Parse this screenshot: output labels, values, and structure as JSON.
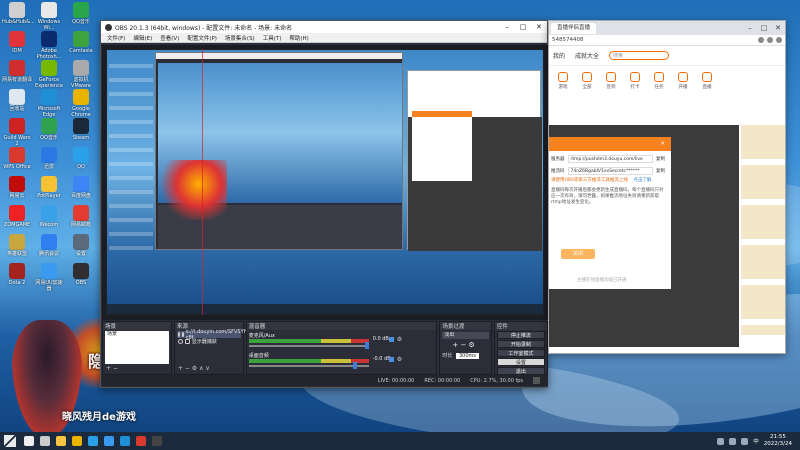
{
  "desktop": {
    "icons": [
      {
        "label": "Hub&Hub&...",
        "color": "#d0d0d0"
      },
      {
        "label": "Windows Wi...",
        "color": "#e8e8e8"
      },
      {
        "label": "QQ音乐",
        "color": "#2aa64a"
      },
      {
        "label": "IDM",
        "color": "#e0343a"
      },
      {
        "label": "Adobe Photosh...",
        "color": "#0c2a6e"
      },
      {
        "label": "Camtasia",
        "color": "#3ea23e"
      },
      {
        "label": "网易有道翻译",
        "color": "#d02e2e"
      },
      {
        "label": "GeForce Experience",
        "color": "#76b900"
      },
      {
        "label": "虚拟机 VMware",
        "color": "#aaaaaa"
      },
      {
        "label": "回收站",
        "color": "#dfe8f0"
      },
      {
        "label": "Microsoft Edge",
        "color": "#1f8fd6"
      },
      {
        "label": "Google Chrome",
        "color": "#e8b400"
      },
      {
        "label": "Guild Wars 2",
        "color": "#c22"
      },
      {
        "label": "QQ音乐",
        "color": "#30a14e"
      },
      {
        "label": "Steam",
        "color": "#1b2838"
      },
      {
        "label": "WPS Office",
        "color": "#d83a2d"
      },
      {
        "label": "迅雷",
        "color": "#2b79e2"
      },
      {
        "label": "QQ",
        "color": "#2aa0e8"
      },
      {
        "label": "网易云",
        "color": "#c20c0c"
      },
      {
        "label": "PotPlayer",
        "color": "#f6c234"
      },
      {
        "label": "百度网盘",
        "color": "#3b85f5"
      },
      {
        "label": "ZOMGAME",
        "color": "#e22"
      },
      {
        "label": "Wecom",
        "color": "#3aa0e8"
      },
      {
        "label": "网易邮箱",
        "color": "#e23b30"
      },
      {
        "label": "英雄联盟",
        "color": "#c8a640"
      },
      {
        "label": "腾讯会议",
        "color": "#2f7ff0"
      },
      {
        "label": "设置",
        "color": "#5a6a7a"
      },
      {
        "label": "Dota 2",
        "color": "#a3231d"
      },
      {
        "label": "网易UU加速器",
        "color": "#3a9af0"
      },
      {
        "label": "OBS",
        "color": "#302e31"
      }
    ],
    "mascot_logo": "隐轩",
    "mascot_sub": "晓风残月de游戏"
  },
  "obs": {
    "title": "OBS 20.1.3 (64bit, windows) - 配置文件: 未命名 - 场景: 未命名",
    "menu": [
      "文件(F)",
      "编辑(E)",
      "查看(V)",
      "配置文件(P)",
      "场景集合(S)",
      "工具(T)",
      "帮助(H)"
    ],
    "docks": {
      "scenes_title": "场景",
      "scenes": [
        "场景"
      ],
      "sources_title": "来源",
      "sources": [
        "s://t.douyin.com/SFV5YH0uA1-c8f",
        "显示器捕获"
      ],
      "mixer_title": "混音器",
      "mixer": [
        {
          "name": "麦克风/Aux",
          "db": "0.0 dB"
        },
        {
          "name": "桌面音频",
          "db": "-0.0 dB"
        }
      ],
      "transitions_title": "场景过渡",
      "transition_type": "淡出",
      "duration_label": "时长",
      "duration_value": "300ms",
      "controls_title": "控件",
      "controls": [
        "停止推流",
        "开始录制",
        "工作室模式",
        "设置",
        "退出"
      ]
    },
    "status": {
      "live": "LIVE: 00:00:00",
      "rec": "REC: 00:00:00",
      "cpu": "CPU: 2.7%, 30.00 fps"
    }
  },
  "browser": {
    "tab_title": "直播伴侣直播",
    "url": "548574408",
    "nav": [
      "我的",
      "成就大全"
    ],
    "search_placeholder": "搜索",
    "categories": [
      "游戏",
      "全部",
      "签到",
      "打卡",
      "任务",
      "开播",
      "直播"
    ],
    "dialog": {
      "close": "✕",
      "field1_label": "服务器",
      "field1_value": "rtmp://pushdm3.douyu.com/live",
      "field1_copy": "复制",
      "field2_label": "推流码",
      "field2_value": "74nZ6BgabIV1xxSecretc******",
      "field2_copy": "复制",
      "note": "请使用OBS等第三方推流工具推流上线",
      "note_link": "点击了解",
      "tip": "直播码每次开播后都会更新生成直播码，每个直播码只对应一次有效，请勿泄露，如果推流地址失效请重新获取rtmp地址发生变化。",
      "ok": "关闭",
      "foot": "主播在线直播功能已开通"
    }
  },
  "taskbar": {
    "apps": [
      {
        "name": "search-icon",
        "color": "#eeeeee"
      },
      {
        "name": "taskview-icon",
        "color": "#cccccc"
      },
      {
        "name": "explorer-icon",
        "color": "#f5c542"
      },
      {
        "name": "chrome-icon",
        "color": "#e8b400"
      },
      {
        "name": "qq-icon",
        "color": "#2aa0e8"
      },
      {
        "name": "wecom-icon",
        "color": "#3a9af0"
      },
      {
        "name": "edge-icon",
        "color": "#1f8fd6"
      },
      {
        "name": "app-icon",
        "color": "#d83a2d"
      },
      {
        "name": "obs-icon",
        "color": "#444444"
      }
    ],
    "lang": "中",
    "time": "21:55",
    "date": "2022/3/24"
  }
}
